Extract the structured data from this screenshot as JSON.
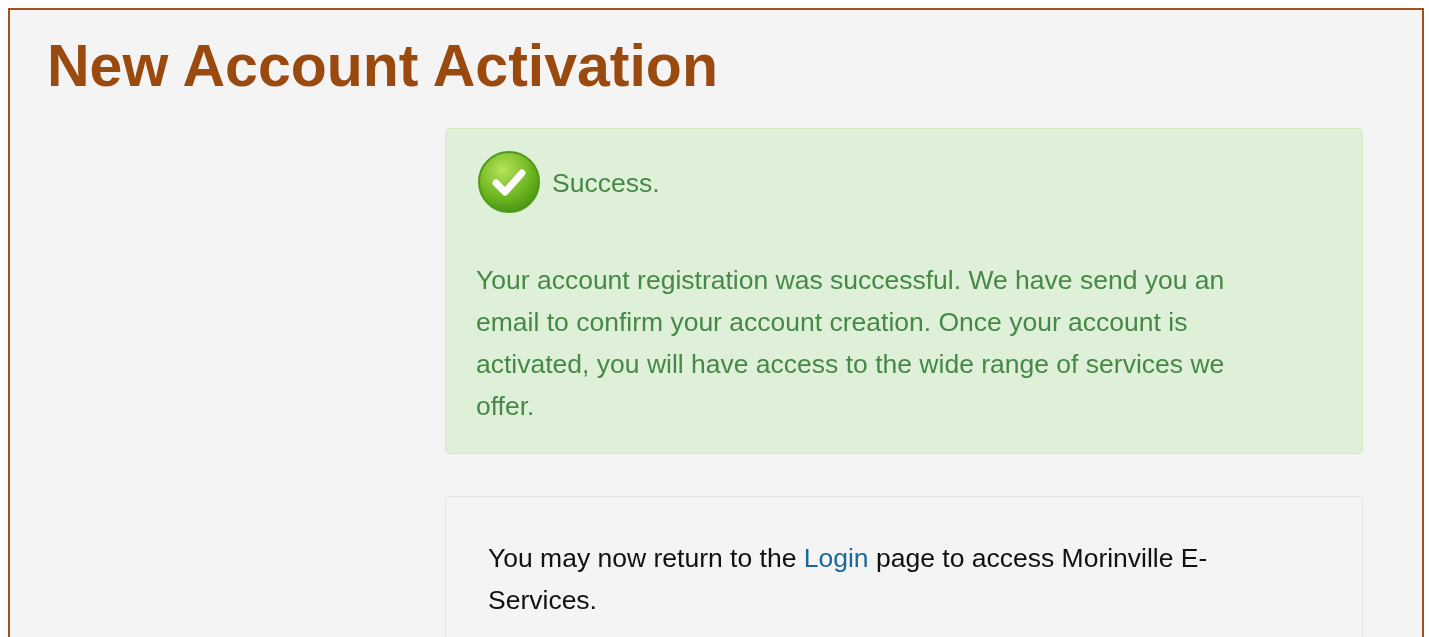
{
  "page_title": "New Account Activation",
  "alert": {
    "kind": "success",
    "heading": "Success.",
    "message": "Your account registration was successful. We have send you an email to confirm your account creation. Once your account is activated, you will have access to the wide range of services we offer."
  },
  "info_panel": {
    "text_before": "You may now return to the ",
    "link": "Login",
    "text_after": " page to access Morinville E-Services."
  }
}
